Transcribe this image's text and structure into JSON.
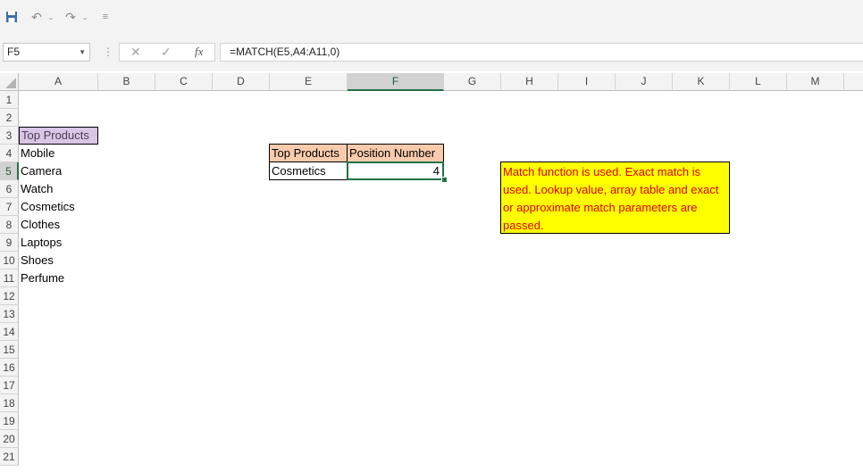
{
  "toolbar": {
    "save_icon": "save-icon",
    "undo_icon": "undo-icon",
    "redo_icon": "redo-icon",
    "customize_icon": "customize-qat-icon"
  },
  "formula_bar": {
    "name_box": "F5",
    "cancel": "✕",
    "enter": "✓",
    "fx": "fx",
    "formula": "=MATCH(E5,A4:A11,0)"
  },
  "columns": [
    "A",
    "B",
    "C",
    "D",
    "E",
    "F",
    "G",
    "H",
    "I",
    "J",
    "K",
    "L",
    "M"
  ],
  "rows": [
    "1",
    "2",
    "3",
    "4",
    "5",
    "6",
    "7",
    "8",
    "9",
    "10",
    "11",
    "12",
    "13",
    "14",
    "15",
    "16",
    "17",
    "18",
    "19",
    "20",
    "21"
  ],
  "cells": {
    "A3": "Top Products",
    "A4": "Mobile",
    "A5": "Camera",
    "A6": "Watch",
    "A7": "Cosmetics",
    "A8": "Clothes",
    "A9": "Laptops",
    "A10": "Shoes",
    "A11": "Perfume",
    "E4": "Top Products",
    "F4": "Position Number",
    "E5": "Cosmetics",
    "F5": "4"
  },
  "note": "Match function is used. Exact match is used. Lookup value, array table and exact or approximate match parameters are passed.",
  "colors": {
    "header_fill": "#f8cbad",
    "a3_fill": "#d9c5e6",
    "selection": "#217346",
    "note_fill": "#ffff00",
    "note_text": "#e00000"
  }
}
